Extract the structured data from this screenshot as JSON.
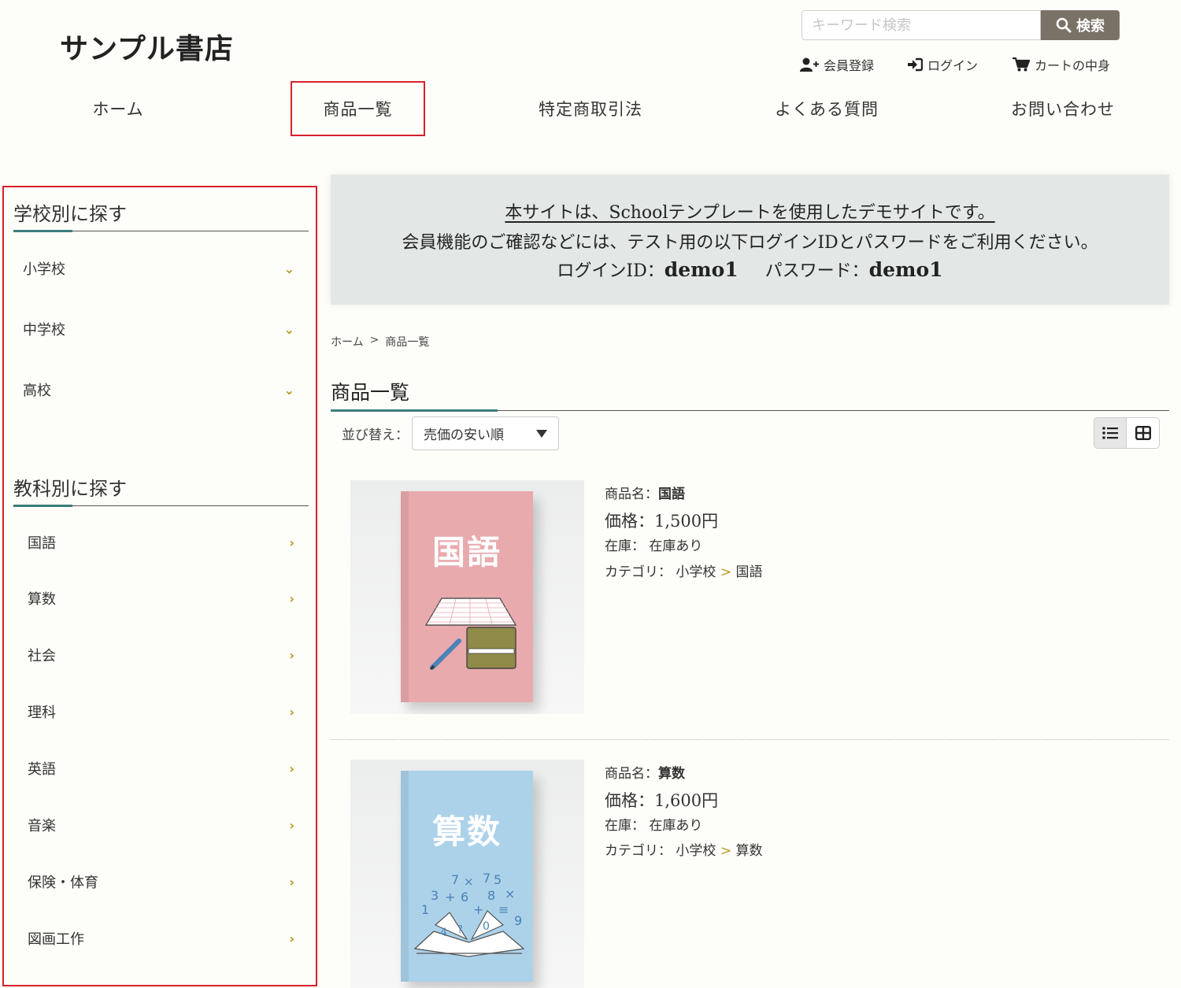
{
  "header": {
    "logo": "サンプル書店",
    "search_placeholder": "キーワード検索",
    "search_button": "検索",
    "links": {
      "register": "会員登録",
      "login": "ログイン",
      "cart": "カートの中身"
    }
  },
  "nav": {
    "home": "ホーム",
    "products": "商品一覧",
    "legal": "特定商取引法",
    "faq": "よくある質問",
    "contact": "お問い合わせ"
  },
  "sidebar": {
    "school_heading": "学校別に探す",
    "schools": [
      "小学校",
      "中学校",
      "高校"
    ],
    "subject_heading": "教科別に探す",
    "subjects": [
      "国語",
      "算数",
      "社会",
      "理科",
      "英語",
      "音楽",
      "保険・体育",
      "図画工作"
    ]
  },
  "banner": {
    "line1": "本サイトは、Schoolテンプレートを使用したデモサイトです。",
    "line2": "会員機能のご確認などには、テスト用の以下ログインIDとパスワードをご利用ください。",
    "id_label": "ログインID：",
    "id_value": "demo1",
    "pw_label": "パスワード：",
    "pw_value": "demo1"
  },
  "breadcrumb": {
    "home": "ホーム",
    "sep": ">",
    "current": "商品一覧"
  },
  "page_title": "商品一覧",
  "sort": {
    "label": "並び替え：",
    "selected": "売価の安い順"
  },
  "colors": {
    "accent_gold": "#b8961b",
    "nav_highlight": "#d8202a",
    "teal_underline": "#3a7e7a",
    "search_button": "#7a7167"
  },
  "products": [
    {
      "cover_title": "国語",
      "cover_color": "#e9aaad",
      "name_label": "商品名：",
      "name": "国語",
      "price_label": "価格：",
      "price": "1,500円",
      "stock_label": "在庫：",
      "stock": "在庫あり",
      "category_label": "カテゴリ：",
      "category_parent": "小学校",
      "category_sep": ">",
      "category_child": "国語"
    },
    {
      "cover_title": "算数",
      "cover_color": "#acd2ea",
      "name_label": "商品名：",
      "name": "算数",
      "price_label": "価格：",
      "price": "1,600円",
      "stock_label": "在庫：",
      "stock": "在庫あり",
      "category_label": "カテゴリ：",
      "category_parent": "小学校",
      "category_sep": ">",
      "category_child": "算数"
    }
  ]
}
